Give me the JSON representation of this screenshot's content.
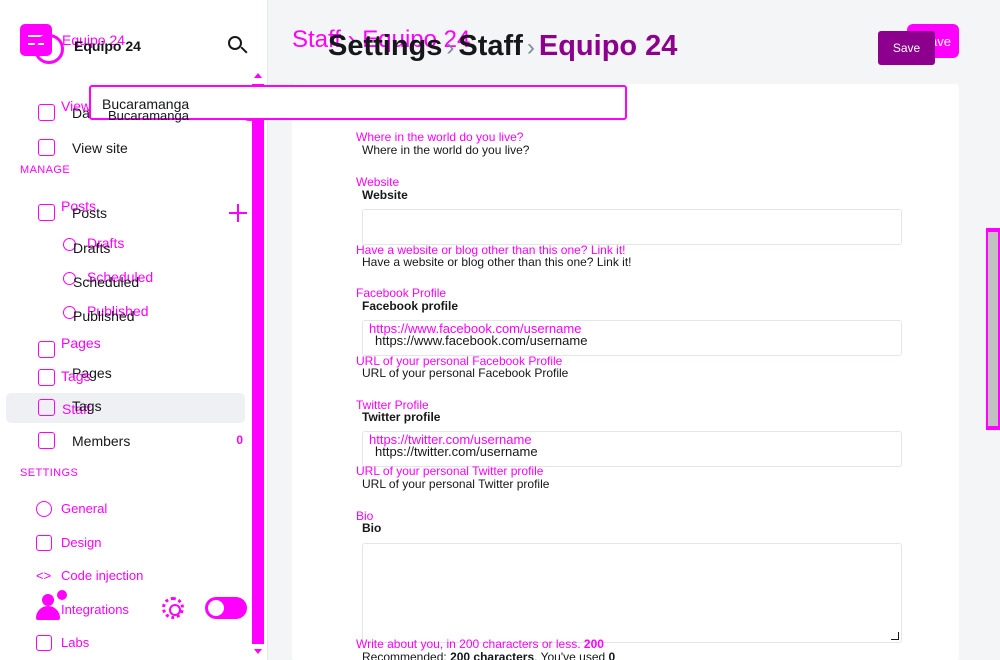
{
  "app": {
    "site_name": "Equipo 24"
  },
  "sidebar": {
    "primary": [
      {
        "label": "Dashboard",
        "ghost": "View site"
      },
      {
        "label": "View site",
        "ghost": ""
      }
    ],
    "manage_heading": "MANAGE",
    "posts": {
      "label": "Posts",
      "ghost": "Posts"
    },
    "post_subitems": [
      {
        "label": "Drafts",
        "ghost": "Drafts"
      },
      {
        "label": "Scheduled",
        "ghost": "Scheduled"
      },
      {
        "label": "Published",
        "ghost": "Published"
      }
    ],
    "pages": {
      "label": "Pages",
      "ghost": "Pages"
    },
    "tags": {
      "label": "Tags",
      "ghost": "Tags"
    },
    "staff": {
      "label": "Staff",
      "ghost": "Tags"
    },
    "members": {
      "label": "Members",
      "count": "0"
    },
    "settings_heading": "SETTINGS",
    "settings_items": [
      {
        "label": "General"
      },
      {
        "label": "Design"
      },
      {
        "label": "Code injection"
      },
      {
        "label": "Integrations"
      },
      {
        "label": "Labs"
      }
    ]
  },
  "header": {
    "ghost_crumb": "Staff › Equipo 24",
    "crumb_settings": "Settings",
    "crumb_sep": "›",
    "crumb_staff": "Staff",
    "crumb_current": "Equipo 24",
    "save_label": "Save",
    "save_ghost": "Save"
  },
  "form": {
    "location_value": "Bucaramanga",
    "location_help": "Where in the world do you live?",
    "website": {
      "label_ghost": "Website",
      "label": "Website",
      "value": "",
      "help": "Have a website or blog other than this one? Link it!"
    },
    "facebook": {
      "label_ghost": "Facebook Profile",
      "label": "Facebook profile",
      "value": "https://www.facebook.com/username",
      "help_ghost": "URL of your personal Facebook Profile",
      "help": "URL of your personal Facebook Profile"
    },
    "twitter": {
      "label_ghost": "Twitter Profile",
      "label": "Twitter profile",
      "value": "https://twitter.com/username",
      "help_ghost": "URL of your personal Twitter profile",
      "help": "URL of your personal Twitter profile"
    },
    "bio": {
      "label_ghost": "Bio",
      "label": "Bio",
      "value": "",
      "help_ghost": "Write about you, in 200 characters or less.",
      "help_ghost_count": "200",
      "help_prefix": "Recommended:",
      "help_count": "200 characters",
      "help_mid": ". You've used",
      "help_used": "0"
    }
  },
  "colors": {
    "accent": "#ff00ff",
    "brand_purple": "#8d008d",
    "text": "#15171a"
  }
}
